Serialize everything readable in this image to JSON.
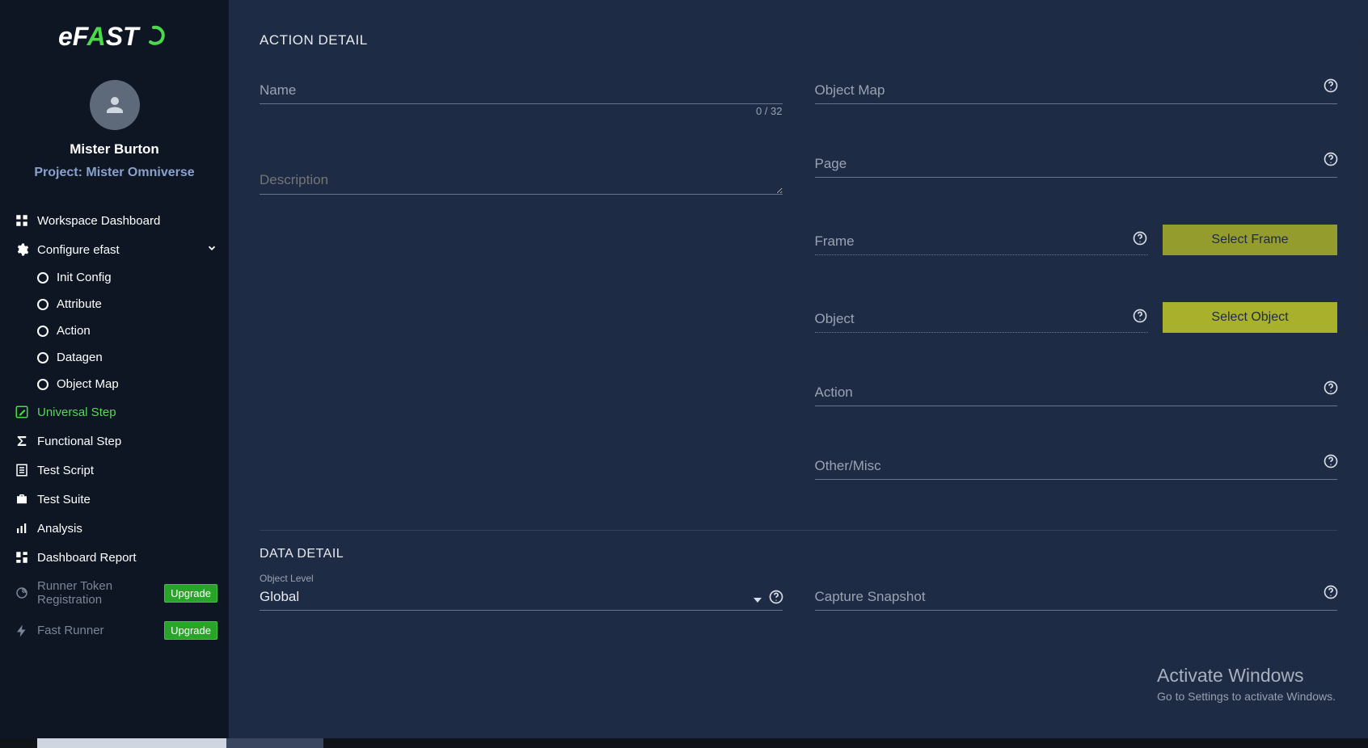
{
  "brand": {
    "name": "eFAST"
  },
  "user": {
    "name": "Mister Burton",
    "project": "Project: Mister Omniverse"
  },
  "sidebar": {
    "items": [
      {
        "label": "Workspace Dashboard",
        "icon": "grid-icon"
      },
      {
        "label": "Configure efast",
        "icon": "gear-icon",
        "expandable": true
      }
    ],
    "subitems": [
      {
        "label": "Init Config"
      },
      {
        "label": "Attribute"
      },
      {
        "label": "Action"
      },
      {
        "label": "Datagen"
      },
      {
        "label": "Object Map"
      }
    ],
    "items2": [
      {
        "label": "Universal Step",
        "icon": "pencil-icon",
        "active": true
      },
      {
        "label": "Functional Step",
        "icon": "sigma-icon"
      },
      {
        "label": "Test Script",
        "icon": "list-icon"
      },
      {
        "label": "Test Suite",
        "icon": "briefcase-icon"
      },
      {
        "label": "Analysis",
        "icon": "chart-icon"
      },
      {
        "label": "Dashboard Report",
        "icon": "dashboard-icon"
      }
    ],
    "items3": [
      {
        "label": "Runner Token Registration",
        "icon": "fingerprint-icon",
        "badge": "Upgrade"
      },
      {
        "label": "Fast Runner",
        "icon": "bolt-icon",
        "badge": "Upgrade"
      }
    ]
  },
  "action_detail": {
    "title": "ACTION DETAIL",
    "name_label": "Name",
    "name_counter": "0 / 32",
    "description_label": "Description",
    "object_map_label": "Object Map",
    "page_label": "Page",
    "frame_label": "Frame",
    "select_frame_btn": "Select Frame",
    "object_label": "Object",
    "select_object_btn": "Select Object",
    "action_label": "Action",
    "other_label": "Other/Misc"
  },
  "data_detail": {
    "title": "DATA DETAIL",
    "object_level_mini": "Object Level",
    "object_level_value": "Global",
    "capture_label": "Capture Snapshot"
  },
  "watermark": {
    "line1": "Activate Windows",
    "line2": "Go to Settings to activate Windows."
  }
}
